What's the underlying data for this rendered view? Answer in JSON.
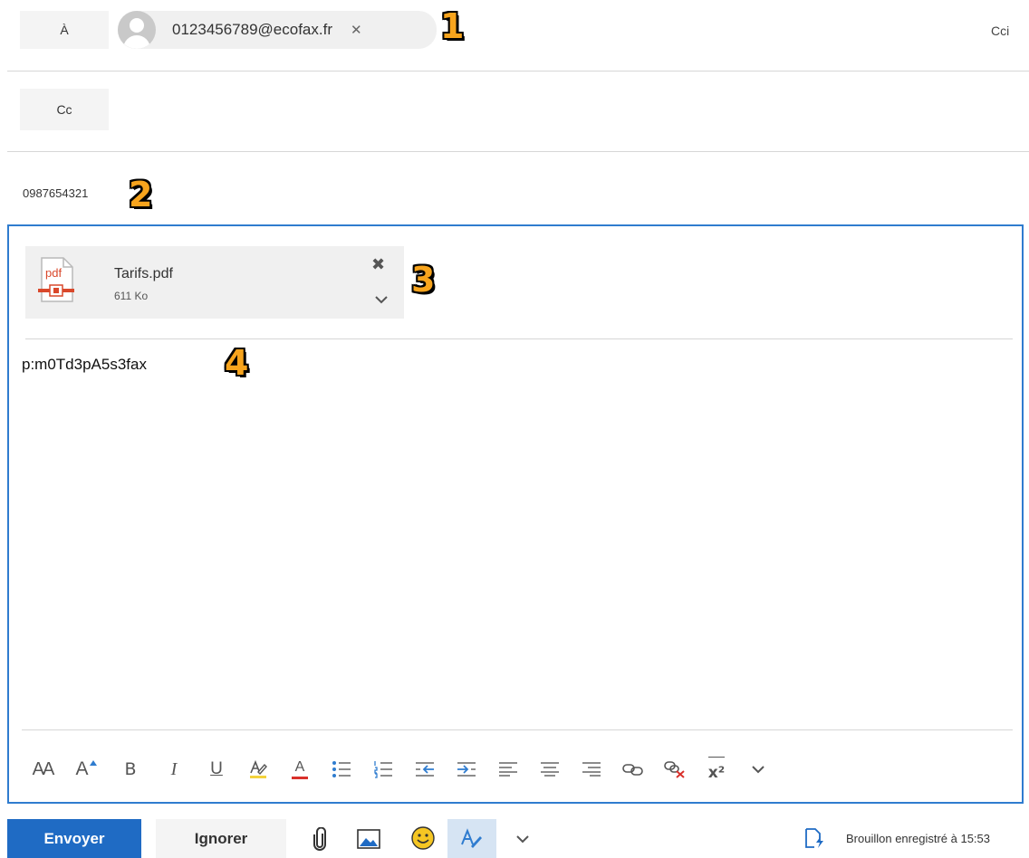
{
  "recipients": {
    "to_label": "À",
    "to_chip_email": "0123456789@ecofax.fr",
    "to_chip_remove": "✕",
    "cc_label": "Cc",
    "bcc_label": "Cci"
  },
  "subject": {
    "value": "0987654321"
  },
  "attachment": {
    "icon_text": "pdf",
    "name": "Tarifs.pdf",
    "size": "611 Ko",
    "remove": "✖"
  },
  "body": {
    "text": "p:m0Td3pA5s3fax"
  },
  "badges": [
    "1",
    "2",
    "3",
    "4"
  ],
  "toolbar": {
    "font_size_label": "AA",
    "grow_label": "A",
    "bold_label": "B",
    "italic_label": "I",
    "underline_label": "U",
    "font_color_label": "A",
    "superscript_label": "x²"
  },
  "footer": {
    "send_label": "Envoyer",
    "discard_label": "Ignorer",
    "status": "Brouillon enregistré à 15:53"
  },
  "colors": {
    "accent": "#1f6bc4",
    "editor_border": "#2f7ccf",
    "badge": "#f7a41d",
    "pdf_red": "#d9482b",
    "highlight_yellow": "#f3d23c",
    "font_red": "#d9302b"
  }
}
